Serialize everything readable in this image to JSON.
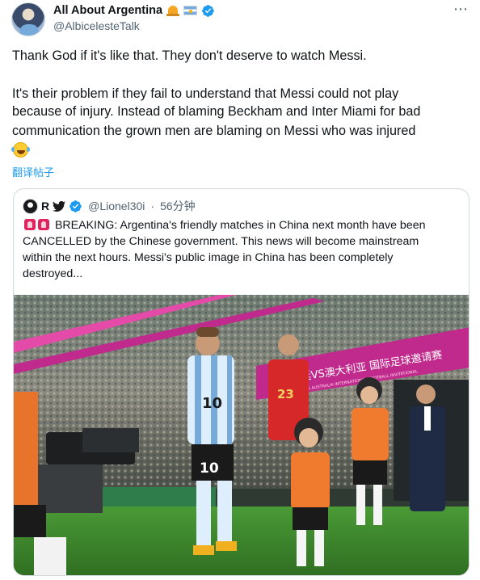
{
  "tweet": {
    "author": {
      "display_name": "All About Argentina",
      "handle": "@AlbicelesteTalk",
      "badges": [
        "bell-emoji",
        "argentina-flag-emoji",
        "verified-badge"
      ]
    },
    "more_icon": "⋯",
    "text_line_1": "Thank God if it's like that. They don't deserve to watch Messi.",
    "text_line_2": "It's their problem if they fail to understand that Messi could not play",
    "text_line_3": "because of injury. Instead of blaming Beckham and Inter Miami for bad",
    "text_line_4": "communication the grown men are blaming on Messi who was injured",
    "trailing_emoji": "rolling-on-floor-laughing-emoji",
    "translate_label": "翻译帖子"
  },
  "quoted_tweet": {
    "display_name": "R",
    "handle": "@Lionel30i",
    "separator": "·",
    "time": "56分钟",
    "text_line_1": "BREAKING: Argentina's friendly matches in China next month have been",
    "text_line_2": "CANCELLED by the Chinese government. This news will become mainstream",
    "text_line_3": "within the next hours. Messi's public image in China has been completely",
    "text_line_4": "destroyed...",
    "photo": {
      "banner_text": "阿根廷VS澳大利亚 国际足球邀请赛",
      "banner_subtext": "ARGENTINA VS AUSTRALIA INTERNATIONAL FOOTBALL INVITATIONAL",
      "player_number_left": "10",
      "player_number_right": "23",
      "shorts_number": "10"
    }
  },
  "colors": {
    "link": "#1d9bf0",
    "secondary_text": "#536471",
    "border": "#cfd9de",
    "argentina_blue": "#75aadb",
    "pitch_green": "#3e8a2c",
    "banner_magenta": "#c02a8c"
  }
}
